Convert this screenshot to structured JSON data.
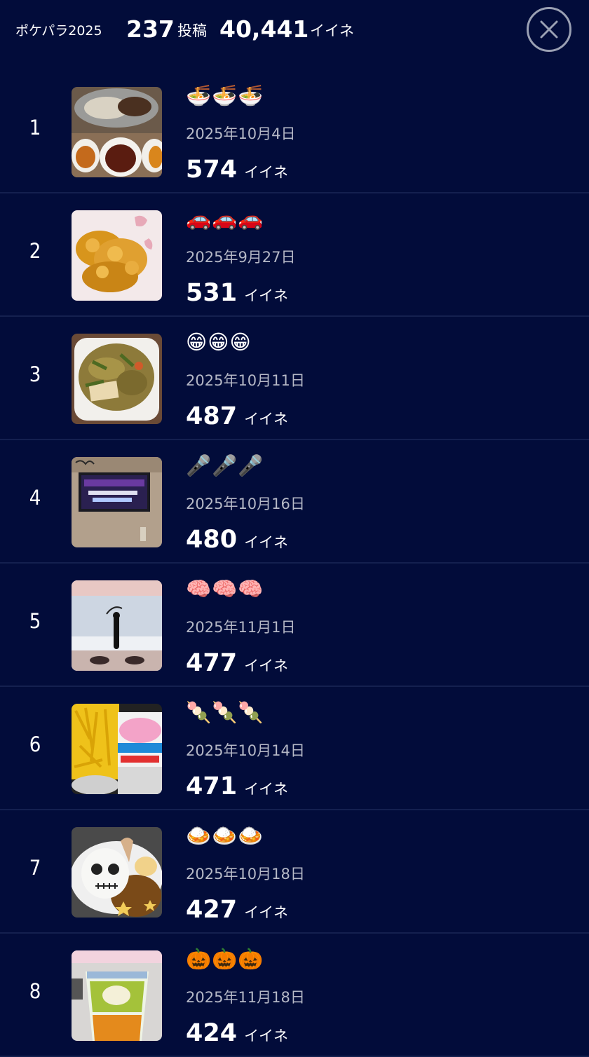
{
  "header": {
    "title": "ポケパラ2025",
    "posts_count": "237",
    "posts_label": "投稿",
    "likes_count": "40,441",
    "likes_label": "イイネ"
  },
  "close_icon": "close-icon",
  "likes_unit": "イイネ",
  "posts": [
    {
      "rank": "1",
      "emoji": "🍜🍜🍜",
      "date": "2025年10月4日",
      "likes": "574",
      "thumb": "food-icon"
    },
    {
      "rank": "2",
      "emoji": "🚗🚗🚗",
      "date": "2025年9月27日",
      "likes": "531",
      "thumb": "food-icon"
    },
    {
      "rank": "3",
      "emoji": "😁😁😁",
      "date": "2025年10月11日",
      "likes": "487",
      "thumb": "food-icon"
    },
    {
      "rank": "4",
      "emoji": "🎤🎤🎤",
      "date": "2025年10月16日",
      "likes": "480",
      "thumb": "karaoke-icon"
    },
    {
      "rank": "5",
      "emoji": "🧠🧠🧠",
      "date": "2025年11月1日",
      "likes": "477",
      "thumb": "photo-icon"
    },
    {
      "rank": "6",
      "emoji": "🍡🍡🍡",
      "date": "2025年10月14日",
      "likes": "471",
      "thumb": "food-icon"
    },
    {
      "rank": "7",
      "emoji": "🍛🍛🍛",
      "date": "2025年10月18日",
      "likes": "427",
      "thumb": "food-icon"
    },
    {
      "rank": "8",
      "emoji": "🎃🎃🎃",
      "date": "2025年11月18日",
      "likes": "424",
      "thumb": "drink-icon"
    }
  ],
  "colors": {
    "background": "#020c3a",
    "divider": "#14204f",
    "date_text": "#b5b8c6",
    "close_ring": "#9aa0b3"
  }
}
